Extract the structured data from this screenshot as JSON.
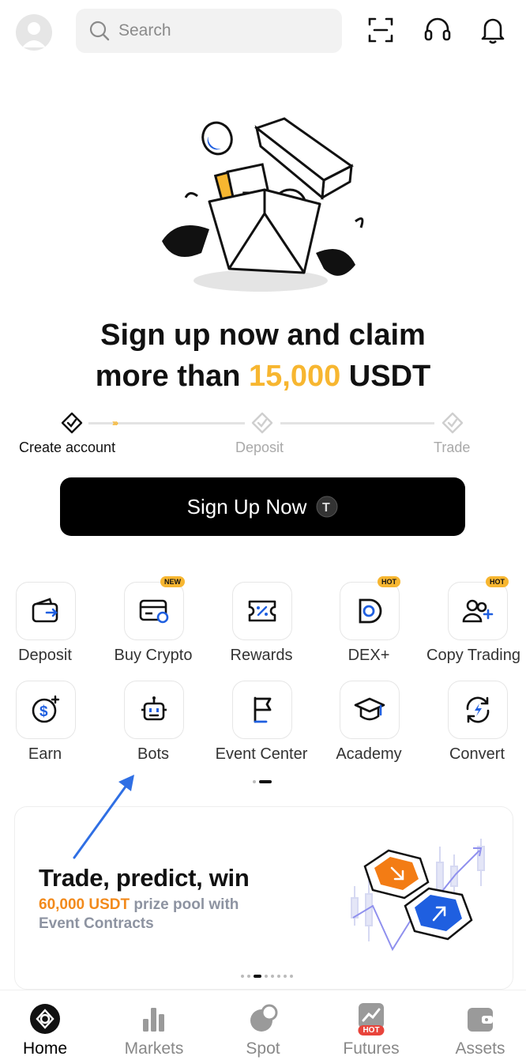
{
  "topbar": {
    "search_placeholder": "Search",
    "icons": [
      "avatar-icon",
      "search-icon",
      "scan-icon",
      "headset-icon",
      "bell-icon"
    ]
  },
  "hero": {
    "title_line1": "Sign up now and claim",
    "title_line2_prefix": "more than ",
    "title_amount": "15,000",
    "title_line2_suffix": " USDT",
    "steps": [
      "Create account",
      "Deposit",
      "Trade"
    ],
    "cta": "Sign Up Now"
  },
  "shortcuts": [
    {
      "label": "Deposit",
      "icon": "wallet-icon",
      "badge": ""
    },
    {
      "label": "Buy Crypto",
      "icon": "card-icon",
      "badge": "NEW"
    },
    {
      "label": "Rewards",
      "icon": "voucher-icon",
      "badge": ""
    },
    {
      "label": "DEX+",
      "icon": "dex-icon",
      "badge": "HOT"
    },
    {
      "label": "Copy Trading",
      "icon": "users-plus-icon",
      "badge": "HOT"
    },
    {
      "label": "Earn",
      "icon": "dollar-coin-icon",
      "badge": ""
    },
    {
      "label": "Bots",
      "icon": "robot-icon",
      "badge": ""
    },
    {
      "label": "Event Center",
      "icon": "flag-icon",
      "badge": ""
    },
    {
      "label": "Academy",
      "icon": "graduation-cap-icon",
      "badge": ""
    },
    {
      "label": "Convert",
      "icon": "convert-icon",
      "badge": ""
    }
  ],
  "banner": {
    "title": "Trade, predict, win",
    "sub_highlight": "60,000 USDT",
    "sub_rest": " prize pool with",
    "sub_line2": "Event Contracts"
  },
  "bottom_nav": [
    {
      "label": "Home",
      "icon": "home-icon",
      "active": true
    },
    {
      "label": "Markets",
      "icon": "markets-icon",
      "active": false
    },
    {
      "label": "Spot",
      "icon": "spot-icon",
      "active": false
    },
    {
      "label": "Futures",
      "icon": "futures-icon",
      "badge": "HOT",
      "active": false
    },
    {
      "label": "Assets",
      "icon": "assets-icon",
      "active": false
    }
  ],
  "colors": {
    "accent": "#f7b630",
    "orange": "#f28a1c",
    "blue": "#1f5fe0",
    "cta_bg": "#000000"
  }
}
